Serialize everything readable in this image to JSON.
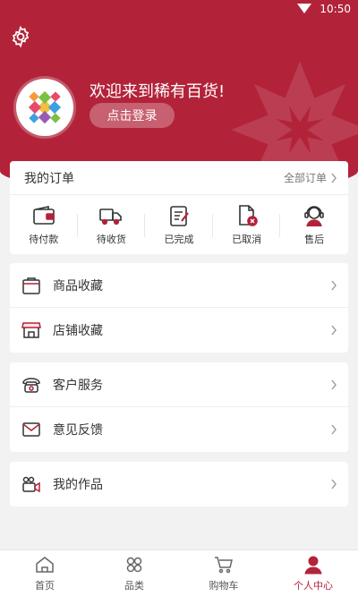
{
  "status": {
    "time": "10:50"
  },
  "header": {
    "welcome": "欢迎来到稀有百货!",
    "login_label": "点击登录"
  },
  "orders": {
    "title": "我的订单",
    "all_label": "全部订单",
    "items": [
      {
        "label": "待付款",
        "icon": "wallet-icon"
      },
      {
        "label": "待收货",
        "icon": "truck-icon"
      },
      {
        "label": "已完成",
        "icon": "clipboard-check-icon"
      },
      {
        "label": "已取消",
        "icon": "document-cancel-icon"
      },
      {
        "label": "售后",
        "icon": "support-agent-icon"
      }
    ]
  },
  "menu_group1": [
    {
      "label": "商品收藏",
      "icon": "bag-icon"
    },
    {
      "label": "店铺收藏",
      "icon": "store-icon"
    }
  ],
  "menu_group2": [
    {
      "label": "客户服务",
      "icon": "telephone-icon"
    },
    {
      "label": "意见反馈",
      "icon": "envelope-icon"
    }
  ],
  "menu_group3": [
    {
      "label": "我的作品",
      "icon": "video-camera-icon"
    }
  ],
  "bottom_nav": [
    {
      "label": "首页",
      "icon": "home-icon"
    },
    {
      "label": "品类",
      "icon": "category-icon"
    },
    {
      "label": "购物车",
      "icon": "cart-icon"
    },
    {
      "label": "个人中心",
      "icon": "person-icon"
    }
  ],
  "colors": {
    "accent": "#b2233a",
    "background": "#f2f2f2"
  }
}
